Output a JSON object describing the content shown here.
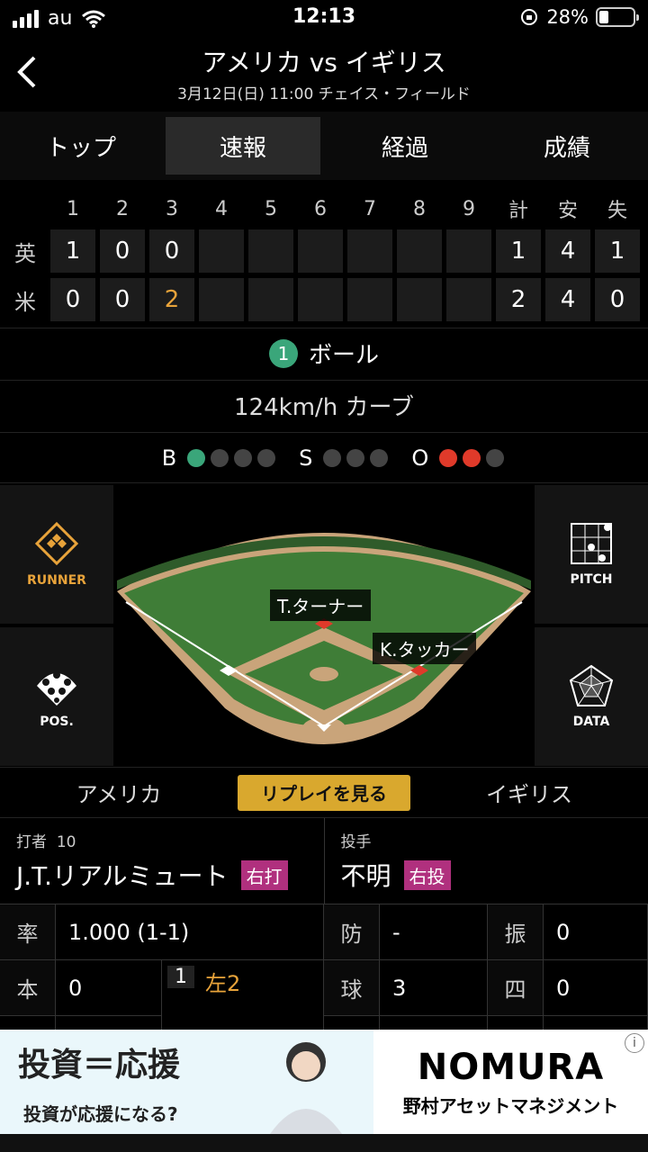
{
  "status": {
    "carrier": "au",
    "time": "12:13",
    "battery": "28%",
    "battery_level": 0.28
  },
  "header": {
    "title": "アメリカ vs イギリス",
    "subtitle": "3月12日(日) 11:00 チェイス・フィールド"
  },
  "tabs": [
    {
      "label": "トップ",
      "active": false
    },
    {
      "label": "速報",
      "active": true
    },
    {
      "label": "経過",
      "active": false
    },
    {
      "label": "成績",
      "active": false
    }
  ],
  "scoreboard": {
    "headers": [
      "1",
      "2",
      "3",
      "4",
      "5",
      "6",
      "7",
      "8",
      "9",
      "計",
      "安",
      "失"
    ],
    "teams": [
      {
        "label": "英",
        "innings": [
          "1",
          "0",
          "0",
          "",
          "",
          "",
          "",
          "",
          "",
          ""
        ],
        "totals": [
          "1",
          "4",
          "1"
        ]
      },
      {
        "label": "米",
        "innings": [
          "0",
          "0",
          "2",
          "",
          "",
          "",
          "",
          "",
          "",
          ""
        ],
        "totals": [
          "2",
          "4",
          "0"
        ]
      }
    ]
  },
  "pitch": {
    "number": "1",
    "result": "ボール",
    "speed_type": "124km/h カーブ"
  },
  "count": {
    "b_label": "B",
    "s_label": "S",
    "o_label": "O",
    "balls": 1,
    "strikes": 0,
    "outs": 2
  },
  "field": {
    "runner_label": "RUNNER",
    "pitch_label": "PITCH",
    "pos_label": "POS.",
    "data_label": "DATA",
    "fielders": [
      {
        "name": "T.ターナー"
      },
      {
        "name": "K.タッカー"
      }
    ]
  },
  "teamrow": {
    "left": "アメリカ",
    "replay": "リプレイを見る",
    "right": "イギリス"
  },
  "batter": {
    "label": "打者",
    "number": "10",
    "name": "J.T.リアルミュート",
    "hand": "右打"
  },
  "pitcher": {
    "label": "投手",
    "name": "不明",
    "hand": "右投"
  },
  "batter_stats": {
    "avg_key": "率",
    "avg_val": "1.000 (1-1)",
    "hr_key": "本",
    "hr_val": "0",
    "ab_no": "1",
    "ab_result": "左2"
  },
  "pitcher_stats": {
    "era_key": "防",
    "era_val": "-",
    "k_key": "振",
    "k_val": "0",
    "np_key": "球",
    "np_val": "3",
    "bb_key": "四",
    "bb_val": "0"
  },
  "ad": {
    "copy1": "投資＝応援",
    "copy2": "投資が応援になる?",
    "brand": "NOMURA",
    "brand_jp": "野村アセットマネジメント"
  },
  "colors": {
    "accent": "#d9a82e",
    "ball": "#3aa67a",
    "out": "#e03a2a",
    "badge": "#b0307e",
    "highlight": "#e8a33a"
  }
}
